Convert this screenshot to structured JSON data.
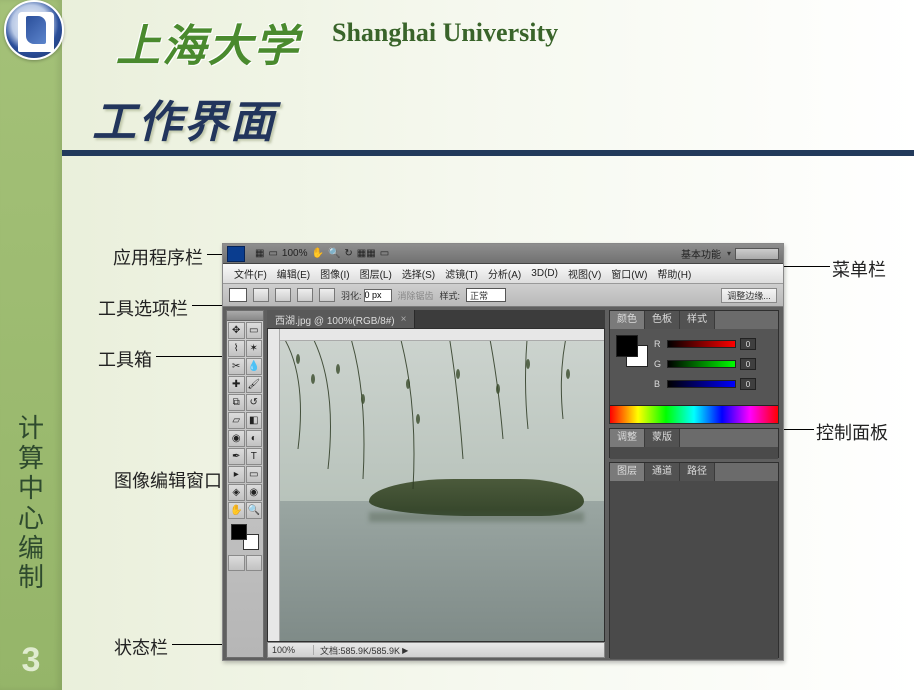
{
  "header": {
    "uni_cn": "上海大学",
    "uni_en": "Shanghai University",
    "title": "工作界面"
  },
  "side": {
    "label": "计算中心编制",
    "page": "3"
  },
  "callouts": {
    "app_bar": "应用程序栏",
    "menu_bar": "菜单栏",
    "options_bar": "工具选项栏",
    "toolbox": "工具箱",
    "image_window": "图像编辑窗口",
    "status_bar": "状态栏",
    "panels": "控制面板"
  },
  "app_bar": {
    "zoom": "100%",
    "workspace": "基本功能"
  },
  "menu": {
    "items": [
      "文件(F)",
      "编辑(E)",
      "图像(I)",
      "图层(L)",
      "选择(S)",
      "滤镜(T)",
      "分析(A)",
      "3D(D)",
      "视图(V)",
      "窗口(W)",
      "帮助(H)"
    ]
  },
  "options": {
    "feather_label": "羽化:",
    "feather_value": "0 px",
    "style_label": "样式:",
    "style_value": "正常",
    "refine": "调整边缘..."
  },
  "doc_tab": {
    "label": "西湖.jpg @ 100%(RGB/8#)"
  },
  "status": {
    "zoom": "100%",
    "doc_info": "文档:585.9K/585.9K"
  },
  "color_panel": {
    "tabs": [
      "颜色",
      "色板",
      "样式"
    ],
    "r_label": "R",
    "g_label": "G",
    "b_label": "B",
    "r": "0",
    "g": "0",
    "b": "0"
  },
  "adjust_panel": {
    "tabs": [
      "调整",
      "蒙版"
    ]
  },
  "layers_panel": {
    "tabs": [
      "图层",
      "通道",
      "路径"
    ]
  }
}
